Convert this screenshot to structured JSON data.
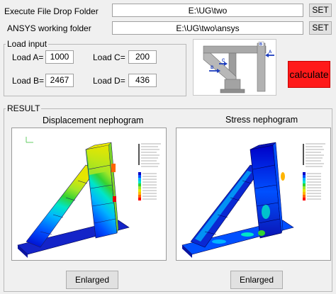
{
  "drop_folder": {
    "label": "Execute File Drop Folder",
    "value": "E:\\UG\\two",
    "set_label": "SET"
  },
  "ansys_folder": {
    "label": "ANSYS working folder",
    "value": "E:\\UG\\two\\ansys",
    "set_label": "SET"
  },
  "load_input": {
    "title": "Load input",
    "a": {
      "label": "Load A=",
      "value": "1000"
    },
    "b": {
      "label": "Load B=",
      "value": "2467"
    },
    "c": {
      "label": "Load C=",
      "value": "200"
    },
    "d": {
      "label": "Load D=",
      "value": "436"
    }
  },
  "diagram": {
    "labels": [
      "A",
      "B",
      "C"
    ]
  },
  "calculate_label": "calculate",
  "result": {
    "title": "RESULT",
    "displacement": {
      "title": "Displacement nephogram",
      "enlarge_label": "Enlarged"
    },
    "stress": {
      "title": "Stress nephogram",
      "enlarge_label": "Enlarged"
    }
  },
  "colors": {
    "calculate": "#ff1a1a",
    "arrow": "#1f3fbf",
    "contour": [
      "#0000c8",
      "#0050ff",
      "#00b4ff",
      "#00e6c8",
      "#32d232",
      "#a0e628",
      "#e6e600",
      "#ffb400",
      "#ff6400",
      "#ff0000"
    ]
  },
  "icons": [
    "arrow-a-icon",
    "arrow-b-icon",
    "arrow-c-icon"
  ]
}
